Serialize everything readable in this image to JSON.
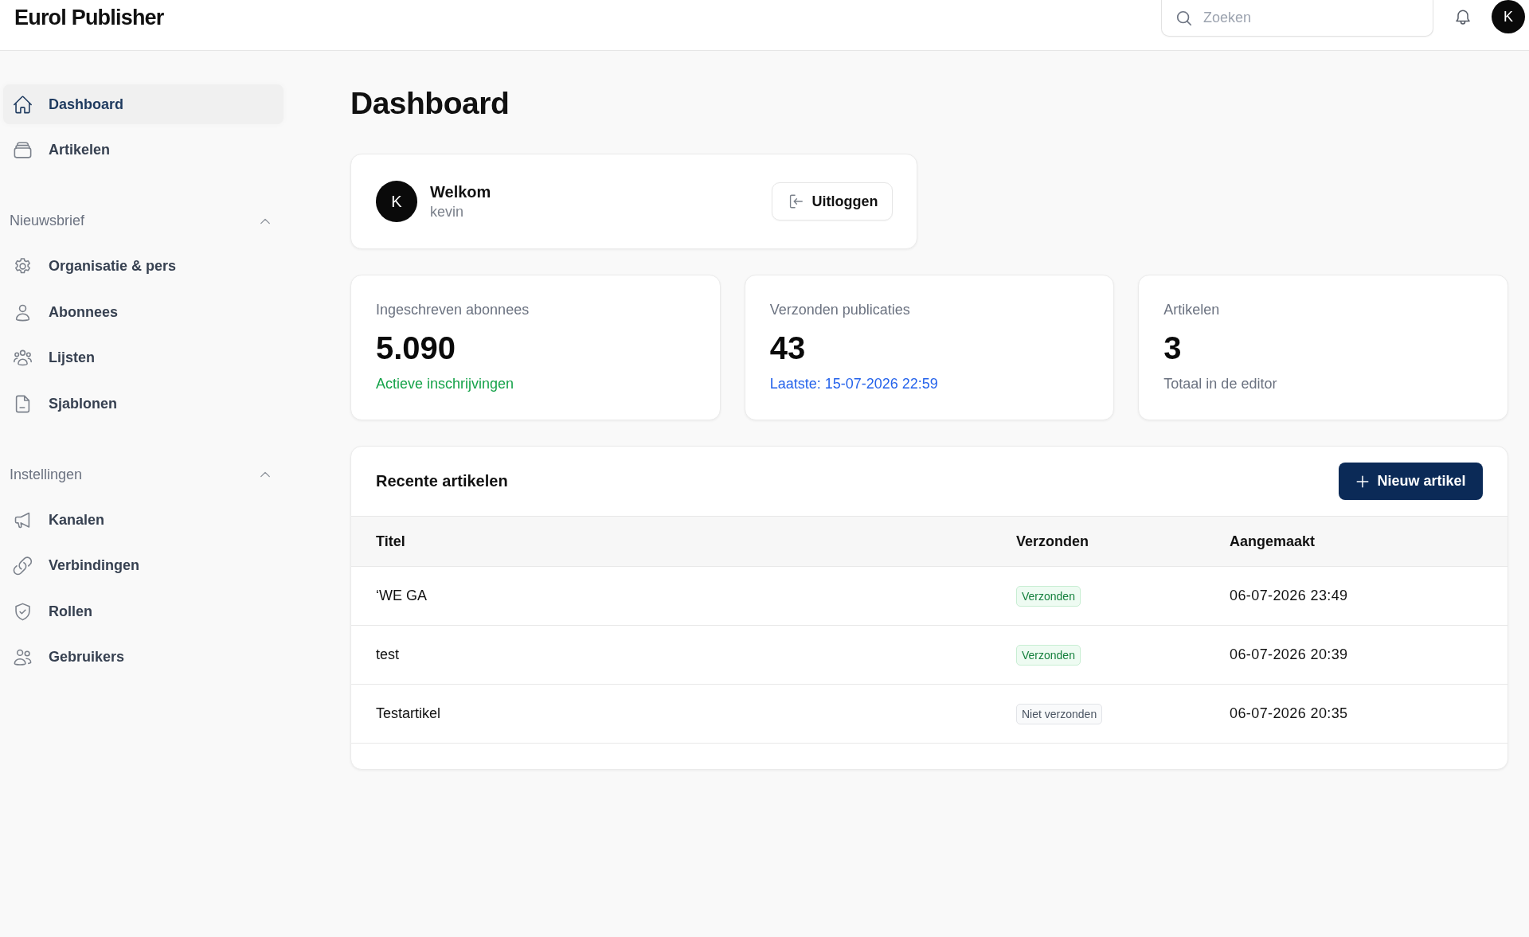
{
  "top_bar": {
    "title": "Eurol Publisher",
    "search": {
      "placeholder": "Zoeken"
    },
    "avatar": "K"
  },
  "sidebar": {
    "groups": [
      {
        "items": [
          {
            "label": "Dashboard",
            "selected": true
          },
          {
            "label": "Artikelen",
            "selected": false
          }
        ]
      },
      {
        "heading": "Nieuwsbrief",
        "expanded": true,
        "items": [
          {
            "label": "Organisatie & pers",
            "selected": false
          },
          {
            "label": "Abonnees",
            "selected": false
          },
          {
            "label": "Lijsten",
            "selected": false
          },
          {
            "label": "Sjablonen",
            "selected": false
          }
        ]
      },
      {
        "heading": "Instellingen",
        "expanded": true,
        "items": [
          {
            "label": "Kanalen",
            "selected": false
          },
          {
            "label": "Verbindingen",
            "selected": false
          },
          {
            "label": "Rollen",
            "selected": false
          },
          {
            "label": "Gebruikers",
            "selected": false
          }
        ]
      }
    ]
  },
  "page_title": "Dashboard",
  "welcome": {
    "avatar": "K",
    "title": "Welkom",
    "user": "kevin",
    "button": "Uitloggen"
  },
  "stats": [
    {
      "label": "Ingeschreven abonnees",
      "value": "5.090",
      "note": "Actieve inschrijvingen",
      "color": "#16a34a"
    },
    {
      "label": "Verzonden publicaties",
      "value": "43",
      "note": "Laatste: 15-07-2026 22:59",
      "color": "#2563eb"
    },
    {
      "label": "Artikelen",
      "value": "3",
      "note": "Totaal in de editor",
      "color": "#6b7280"
    }
  ],
  "recent_articles": {
    "title": "Recente artikelen",
    "button": "Nieuw artikel",
    "columns": [
      "Titel",
      "Verzonden",
      "Aangemaakt"
    ],
    "rows": [
      {
        "title": "‘WE GA",
        "status": {
          "kind": "sent",
          "label": "Verzonden"
        },
        "created": "06-07-2026 23:49"
      },
      {
        "title": "test",
        "status": {
          "kind": "sent",
          "label": "Verzonden"
        },
        "created": "06-07-2026 20:39"
      },
      {
        "title": "Testartikel",
        "status": {
          "kind": "not_sent",
          "label": "Niet verzonden"
        },
        "created": "06-07-2026 20:35"
      }
    ]
  }
}
